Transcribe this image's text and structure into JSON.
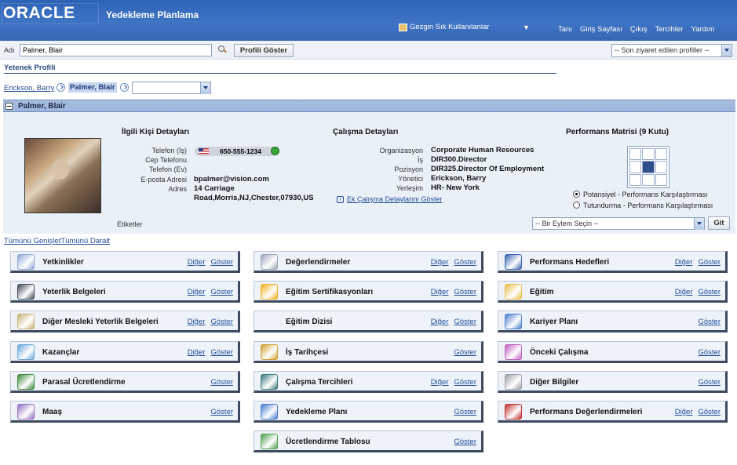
{
  "header": {
    "logo": "ORACLE",
    "app_title": "Yedekleme Planlama",
    "nav_favorites": "Gezgin Sık Kullanılanlar",
    "nav_dropdown": "▼",
    "global_links": [
      "Tanı",
      "Giriş Sayfası",
      "Çıkış",
      "Tercihler",
      "Yardım"
    ]
  },
  "search": {
    "label": "Adı",
    "value": "Palmer, Blair",
    "button": "Profili Göster",
    "recent_select": "-- Son ziyaret edilen profiller --"
  },
  "page_title": "Yetenek Profili",
  "breadcrumb": {
    "first": "Erickson, Barry",
    "second": "Palmer, Blair"
  },
  "section": {
    "title": "Palmer, Blair"
  },
  "contact": {
    "heading": "İlgili Kişi Detayları",
    "labels": [
      "Telefon (İş)",
      "Cep Telefonu",
      "Telefon (Ev)",
      "E-posta Adresi",
      "Adres"
    ],
    "phone": "650-555-1234",
    "email": "bpalmer@vision.com",
    "address_line1": "14 Carriage",
    "address_line2": "Road,Morris,NJ,Chester,07930,US"
  },
  "work": {
    "heading": "Çalışma Detayları",
    "labels": [
      "Organizasyon",
      "İş",
      "Pozisyon",
      "Yönetici",
      "Yerleşim"
    ],
    "values": [
      "Corporate Human Resources",
      "DIR300.Director",
      "DIR325.Director Of Employment",
      "Erickson, Barry",
      "HR- New York"
    ],
    "more_link": "Ek Çalışma Detaylarını Göster"
  },
  "matrix": {
    "heading": "Performans Matrisi (9 Kutu)",
    "active_cell": 4,
    "option1": "Potansiyel - Performans Karşılaştırması",
    "option2": "Tutundurma - Performans Karşılaştırması",
    "selected_option": 1
  },
  "tags_label": "Etiketler",
  "action": {
    "select": "-- Bir Eylem Seçin --",
    "button": "Git"
  },
  "expand_all": "Tümünü Genişlet",
  "collapse_all": "Tümünü Daralt",
  "link_labels": {
    "other": "Diğer",
    "show": "Göster"
  },
  "tiles": [
    {
      "name": "Yetkinlikler",
      "icon": "competencies-icon",
      "other": true,
      "color": "#8fa6d8"
    },
    {
      "name": "Değerlendirmeler",
      "icon": "assessments-icon",
      "other": true,
      "color": "#9aa7b8"
    },
    {
      "name": "Performans Hedefleri",
      "icon": "performance-goals-icon",
      "other": true,
      "color": "#3b63b0"
    },
    {
      "name": "Yeterlik Belgeleri",
      "icon": "qualifications-icon",
      "other": true,
      "color": "#444b55"
    },
    {
      "name": "Eğitim Sertifikasyonları",
      "icon": "certifications-icon",
      "other": true,
      "color": "#f0b020"
    },
    {
      "name": "Eğitim",
      "icon": "education-icon",
      "other": true,
      "color": "#e7c04a"
    },
    {
      "name": "Diğer Mesleki Yeterlik Belgeleri",
      "icon": "other-qualifications-icon",
      "other": true,
      "color": "#c7b27a"
    },
    {
      "name": "Eğitim Dizisi",
      "icon": "",
      "other": true,
      "color": ""
    },
    {
      "name": "Kariyer Planı",
      "icon": "career-plan-icon",
      "other": false,
      "color": "#4f7fd0"
    },
    {
      "name": "Kazançlar",
      "icon": "earnings-icon",
      "other": true,
      "color": "#6aa6d8"
    },
    {
      "name": "İş Tarihçesi",
      "icon": "work-history-icon",
      "other": false,
      "color": "#d0a030"
    },
    {
      "name": "Önceki Çalışma",
      "icon": "previous-employment-icon",
      "other": false,
      "color": "#c060c0"
    },
    {
      "name": "Parasal Ücretlendirme",
      "icon": "monetary-compensation-icon",
      "other": false,
      "color": "#3c8a3c"
    },
    {
      "name": "Çalışma Tercihleri",
      "icon": "work-preferences-icon",
      "other": true,
      "color": "#3a7a7a"
    },
    {
      "name": "Diğer Bilgiler",
      "icon": "other-information-icon",
      "other": false,
      "color": "#9aa0a8"
    },
    {
      "name": "Maaş",
      "icon": "salary-icon",
      "other": false,
      "color": "#9070c0"
    },
    {
      "name": "Yedekleme Planı",
      "icon": "succession-plan-icon",
      "other": false,
      "color": "#4a7ad0"
    },
    {
      "name": "Performans Değerlendirmeleri",
      "icon": "performance-reviews-icon",
      "other": true,
      "color": "#c03030"
    },
    {
      "name": "Ücretlendirme Tablosu",
      "icon": "compensation-table-icon",
      "other": false,
      "color": "#50a050"
    }
  ]
}
